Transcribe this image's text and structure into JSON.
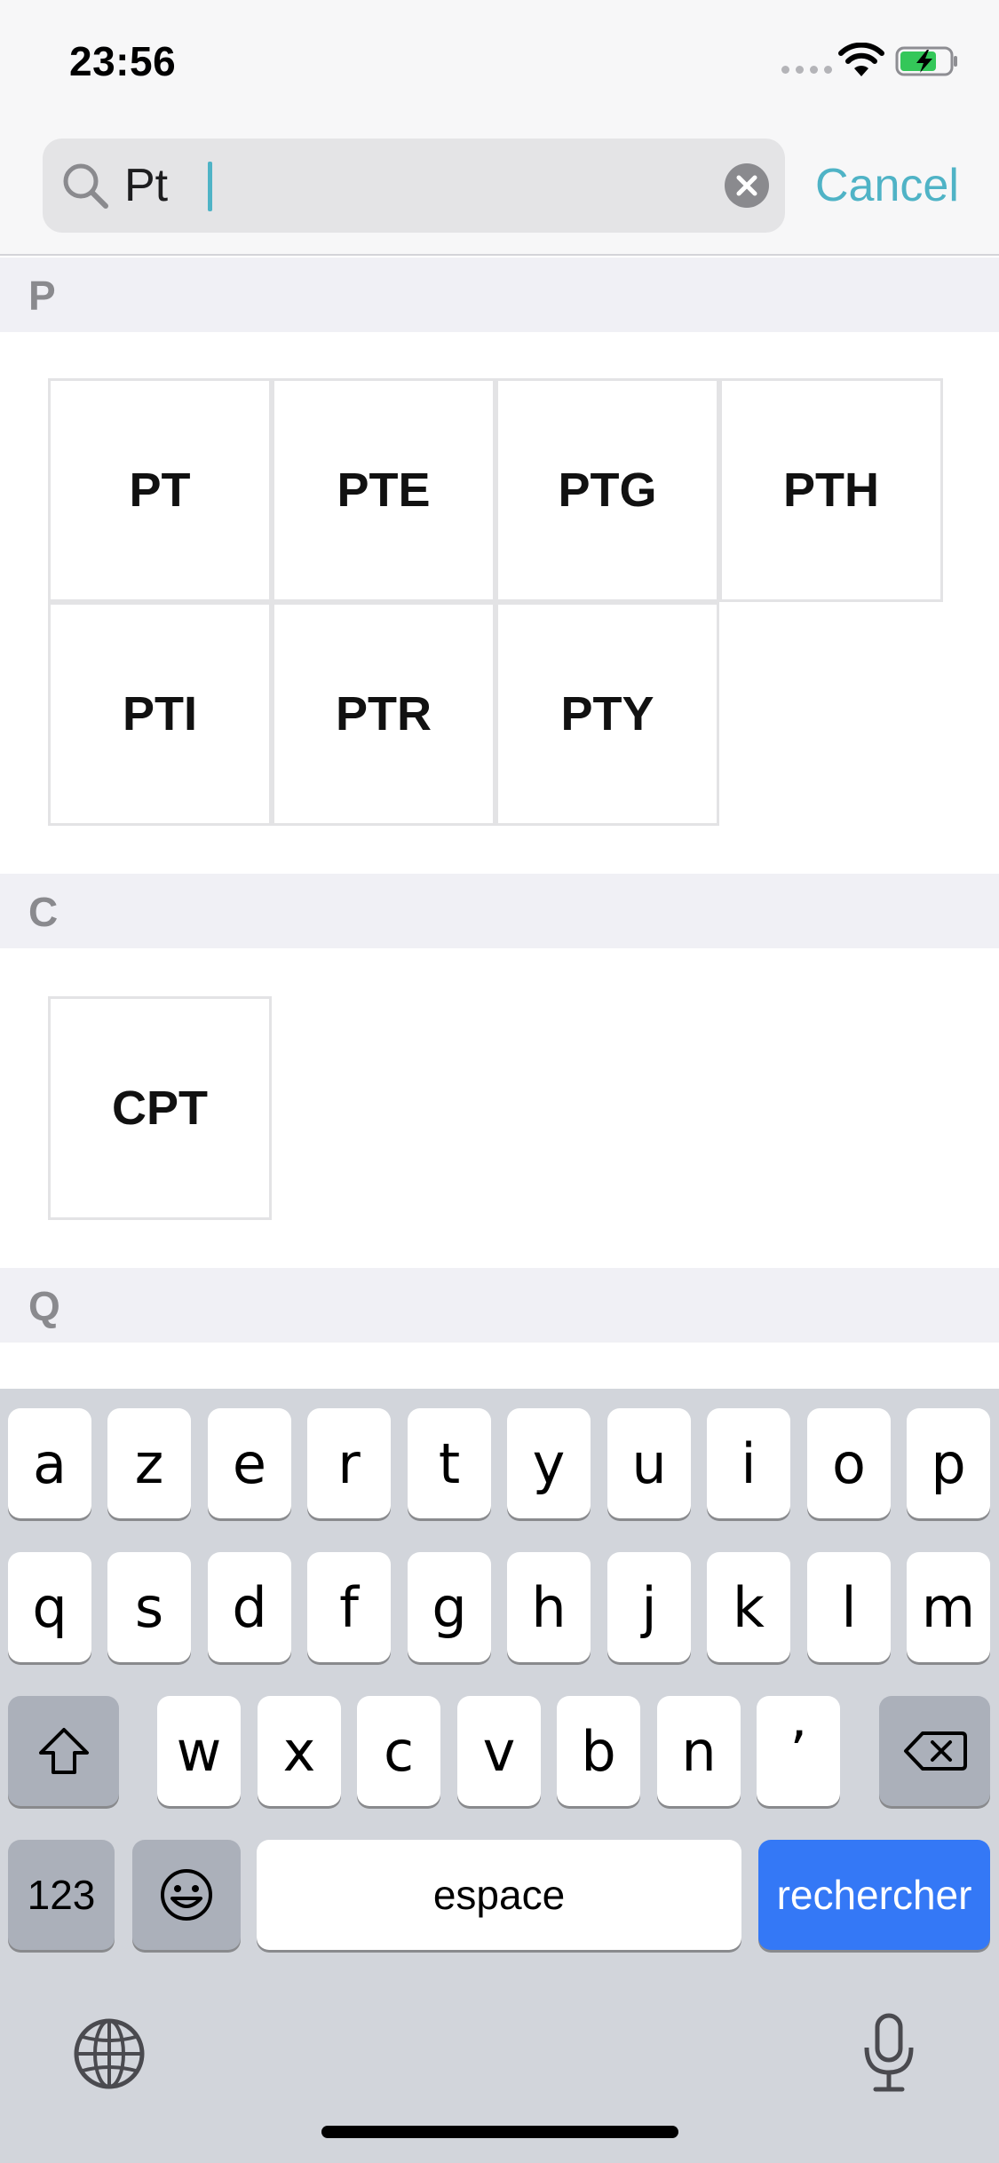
{
  "status_bar": {
    "time": "23:56"
  },
  "search": {
    "query": "Pt",
    "cancel_label": "Cancel"
  },
  "sections": [
    {
      "letter": "P",
      "items": [
        "PT",
        "PTE",
        "PTG",
        "PTH",
        "PTI",
        "PTR",
        "PTY"
      ]
    },
    {
      "letter": "C",
      "items": [
        "CPT"
      ]
    },
    {
      "letter": "Q",
      "items": []
    }
  ],
  "keyboard": {
    "row1": [
      "a",
      "z",
      "e",
      "r",
      "t",
      "y",
      "u",
      "i",
      "o",
      "p"
    ],
    "row2": [
      "q",
      "s",
      "d",
      "f",
      "g",
      "h",
      "j",
      "k",
      "l",
      "m"
    ],
    "row3": [
      "w",
      "x",
      "c",
      "v",
      "b",
      "n",
      "’"
    ],
    "numbers_label": "123",
    "space_label": "espace",
    "return_label": "rechercher",
    "return_color": "#3478f6"
  },
  "icons": [
    "search-icon",
    "clear-icon",
    "wifi-icon",
    "battery-charging-icon",
    "shift-icon",
    "backspace-icon",
    "emoji-icon",
    "globe-icon",
    "microphone-icon"
  ]
}
